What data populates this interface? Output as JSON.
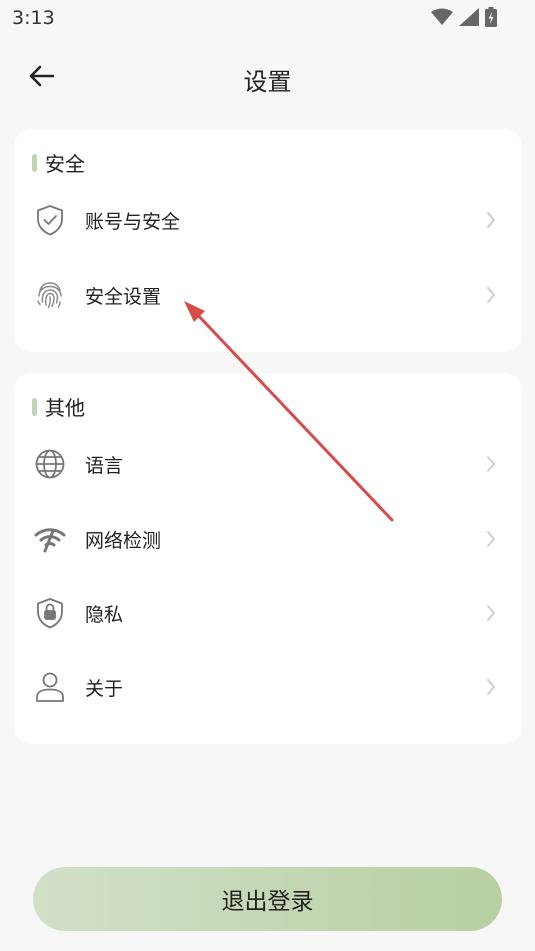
{
  "status_bar": {
    "time": "3:13",
    "icons": [
      "wifi-icon",
      "cellular-signal-icon",
      "battery-charging-icon"
    ]
  },
  "header": {
    "title": "设置",
    "back_icon": "arrow-left-icon"
  },
  "sections": [
    {
      "title": "安全",
      "items": [
        {
          "label": "账号与安全",
          "icon": "shield-check-icon"
        },
        {
          "label": "安全设置",
          "icon": "fingerprint-icon"
        }
      ]
    },
    {
      "title": "其他",
      "items": [
        {
          "label": "语言",
          "icon": "globe-icon"
        },
        {
          "label": "网络检测",
          "icon": "wifi-signal-icon"
        },
        {
          "label": "隐私",
          "icon": "lock-shield-icon"
        },
        {
          "label": "关于",
          "icon": "person-icon"
        }
      ]
    }
  ],
  "logout": {
    "label": "退出登录"
  },
  "colors": {
    "accent_bar": "#c0d6b3",
    "logout_gradient_start": "#d3e0c8",
    "logout_gradient_end": "#b8cfa2",
    "annotation_arrow": "#d94a4a",
    "background": "#f7f7f7"
  }
}
